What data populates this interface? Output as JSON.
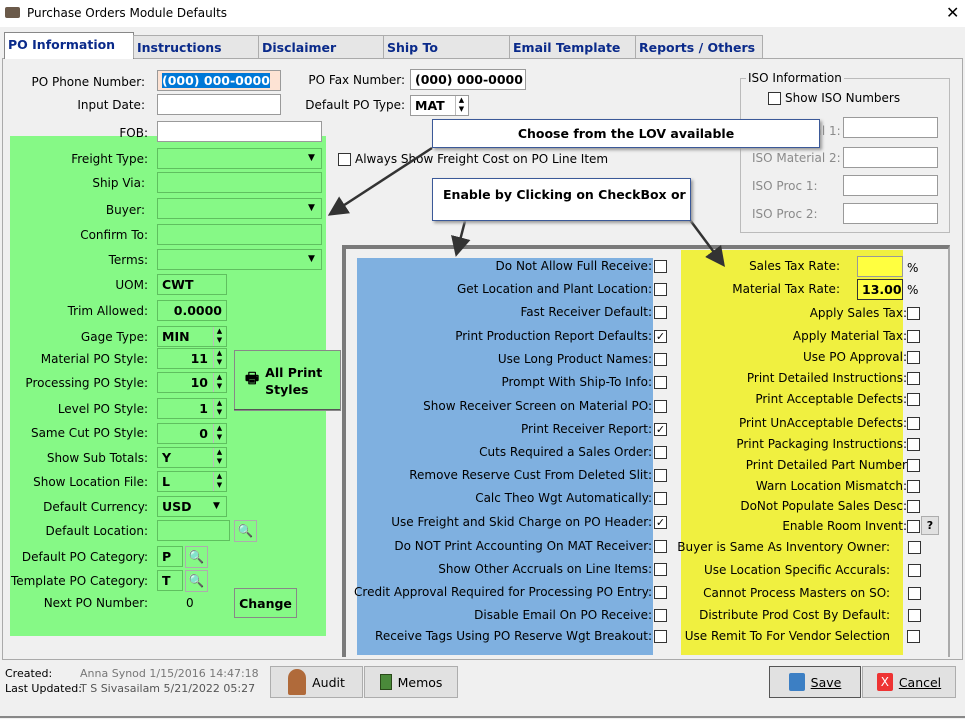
{
  "window": {
    "title": "Purchase Orders Module Defaults",
    "close": "✕"
  },
  "tabs": [
    "PO Information",
    "Instructions",
    "Disclaimer",
    "Ship To",
    "Email Template",
    "Reports / Others"
  ],
  "form": {
    "po_phone_label": "PO Phone Number:",
    "po_phone_value": "(000) 000-0000",
    "input_date_label": "Input Date:",
    "input_date_value": "",
    "fob_label": "FOB:",
    "fob_value": "",
    "freight_type_label": "Freight Type:",
    "ship_via_label": "Ship Via:",
    "buyer_label": "Buyer:",
    "confirm_to_label": "Confirm To:",
    "terms_label": "Terms:",
    "uom_label": "UOM:",
    "uom_value": "CWT",
    "trim_label": "Trim Allowed:",
    "trim_value": "0.0000",
    "gage_label": "Gage Type:",
    "gage_value": "MIN",
    "material_style_label": "Material PO Style:",
    "material_style_value": "11",
    "processing_style_label": "Processing PO Style:",
    "processing_style_value": "10",
    "level_style_label": "Level PO Style:",
    "level_style_value": "1",
    "same_cut_label": "Same Cut PO Style:",
    "same_cut_value": "0",
    "sub_totals_label": "Show Sub Totals:",
    "sub_totals_value": "Y",
    "location_file_label": "Show Location File:",
    "location_file_value": "L",
    "currency_label": "Default Currency:",
    "currency_value": "USD",
    "location_label": "Default Location:",
    "location_value": "",
    "po_category_label": "Default PO Category:",
    "po_category_value": "P",
    "template_category_label": "Template PO Category:",
    "template_category_value": "T",
    "next_po_label": "Next PO Number:",
    "next_po_value": "0",
    "all_print_styles": "All Print Styles",
    "change": "Change",
    "fax_label": "PO Fax Number:",
    "fax_value": "(000) 000-0000",
    "po_type_label": "Default PO Type:",
    "po_type_value": "MAT",
    "always_show_freight": "Always Show Freight Cost on PO Line Item"
  },
  "iso": {
    "title": "ISO Information",
    "show": "Show ISO Numbers",
    "material1": "ISO Material 1:",
    "material2": "ISO Material 2:",
    "proc1": "ISO Proc 1:",
    "proc2": "ISO Proc 2:"
  },
  "callouts": {
    "lov": "Choose from the LOV available",
    "checkbox": "Enable by Clicking on CheckBox or"
  },
  "left_options": [
    {
      "label": "Do Not Allow Full Receive:",
      "checked": false
    },
    {
      "label": "Get Location and Plant Location:",
      "checked": false
    },
    {
      "label": "Fast Receiver Default:",
      "checked": false
    },
    {
      "label": "Print Production Report Defaults:",
      "checked": true
    },
    {
      "label": "Use Long Product Names:",
      "checked": false
    },
    {
      "label": "Prompt With Ship-To Info:",
      "checked": false
    },
    {
      "label": "Show Receiver Screen on Material PO:",
      "checked": false
    },
    {
      "label": "Print Receiver Report:",
      "checked": true
    },
    {
      "label": "Cuts Required a Sales Order:",
      "checked": false
    },
    {
      "label": "Remove Reserve Cust From Deleted Slit:",
      "checked": false
    },
    {
      "label": "Calc Theo Wgt Automatically:",
      "checked": false
    },
    {
      "label": "Use Freight and Skid Charge on PO Header:",
      "checked": true
    },
    {
      "label": "Do NOT Print Accounting On MAT Receiver:",
      "checked": false
    },
    {
      "label": "Show Other Accruals on Line Items:",
      "checked": false
    },
    {
      "label": "Credit Approval Required for Processing PO Entry:",
      "checked": false
    },
    {
      "label": "Disable Email On PO  Receive:",
      "checked": false
    },
    {
      "label": "Receive Tags Using PO Reserve Wgt Breakout:",
      "checked": false
    }
  ],
  "tax": {
    "sales_label": "Sales Tax Rate:",
    "sales_value": "",
    "material_label": "Material Tax Rate:",
    "material_value": "13.000",
    "pct": "%"
  },
  "right_options": [
    {
      "label": "Apply Sales Tax:",
      "checked": false
    },
    {
      "label": "Apply Material Tax:",
      "checked": false
    },
    {
      "label": "Use PO Approval:",
      "checked": false
    },
    {
      "label": "Print Detailed Instructions:",
      "checked": false
    },
    {
      "label": "Print Acceptable Defects:",
      "checked": false
    },
    {
      "label": "Print UnAcceptable Defects:",
      "checked": false
    },
    {
      "label": "Print Packaging Instructions:",
      "checked": false
    },
    {
      "label": "Print Detailed Part Number",
      "checked": false
    },
    {
      "label": "Warn Location Mismatch:",
      "checked": false
    },
    {
      "label": "DoNot Populate Sales Desc:",
      "checked": false
    },
    {
      "label": "Enable Room Invent:",
      "checked": false
    },
    {
      "label": "Buyer is Same As Inventory Owner:",
      "checked": false
    },
    {
      "label": "Use Location Specific Accurals:",
      "checked": false
    },
    {
      "label": "Cannot Process Masters on SO:",
      "checked": false
    },
    {
      "label": "Distribute Prod Cost By Default:",
      "checked": false
    },
    {
      "label": "Use Remit To For Vendor Selection",
      "checked": false
    }
  ],
  "help_button": "?",
  "footer": {
    "created_label": "Created:",
    "created_value": "Anna Synod 1/15/2016 14:47:18",
    "updated_label": "Last Updated:",
    "updated_value": "T S Sivasailam 5/21/2022 05:27",
    "audit": "Audit",
    "memos": "Memos",
    "save": "Save",
    "cancel": "Cancel"
  },
  "colors": {
    "green": "#86f986",
    "blue": "#7fb0e0",
    "yellow": "#f0f040",
    "selection": "#0078d7"
  }
}
